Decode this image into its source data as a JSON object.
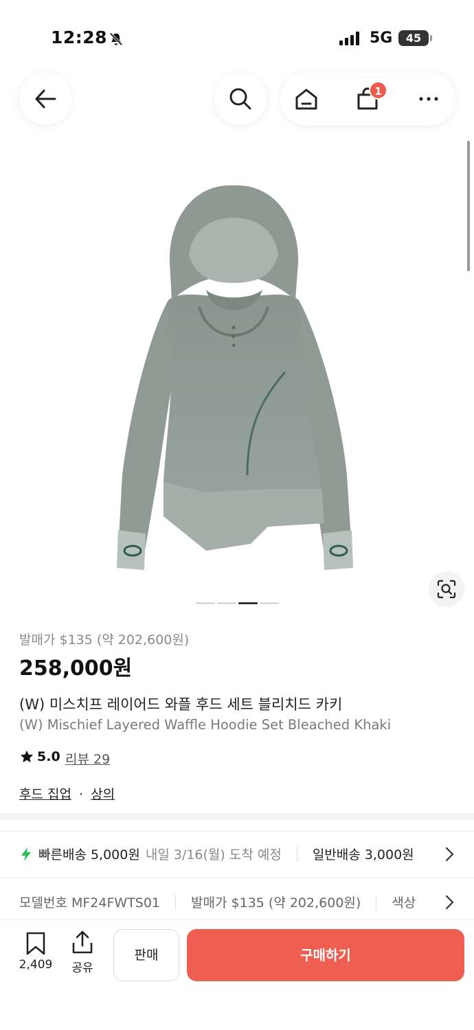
{
  "status_bar": {
    "time": "12:28",
    "network": "5G",
    "battery": "45",
    "icons": [
      "bell-slash-icon",
      "signal-icon"
    ]
  },
  "nav": {
    "icons": [
      "back-arrow-icon",
      "search-icon",
      "home-icon",
      "cart-icon",
      "more-icon"
    ],
    "cart_badge": "1"
  },
  "product": {
    "image_index": 3,
    "image_count": 4,
    "release_price": "발매가 $135 (약 202,600원)",
    "price": "258,000원",
    "name_ko": "(W) 미스치프 레이어드 와플 후드 세트 블리치드 카키",
    "name_en": "(W) Mischief Layered Waffle Hoodie Set Bleached Khaki",
    "rating": "5.0",
    "review_label": "리뷰 29",
    "categories": [
      "후드 집업",
      "상의"
    ],
    "category_separator": "·"
  },
  "shipping": {
    "fast_label": "빠른배송 5,000원",
    "fast_eta": "내일 3/16(월) 도착 예정",
    "normal_label": "일반배송 3,000원",
    "accent": "#2bbf5b"
  },
  "info": {
    "model": "모델번호 MF24FWTS01",
    "release": "발매가 $135 (약 202,600원)",
    "color_label": "색상"
  },
  "bottom_bar": {
    "bookmark_count": "2,409",
    "share_label": "공유",
    "sell_label": "판매",
    "buy_label": "구매하기",
    "buy_color": "#ee5f52"
  }
}
